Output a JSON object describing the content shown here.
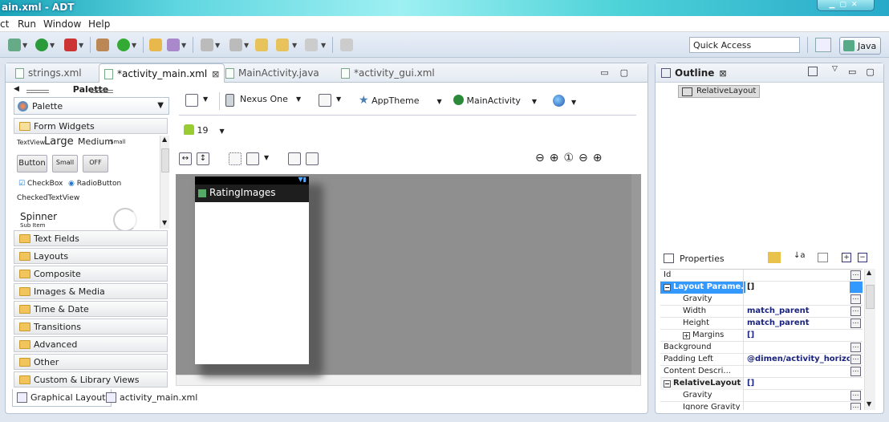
{
  "window": {
    "title": "ain.xml - ADT"
  },
  "menu": {
    "items": [
      "ct",
      "Run",
      "Window",
      "Help"
    ]
  },
  "toolbar": {
    "quick_access": "Quick Access",
    "perspective": "Java"
  },
  "editor": {
    "tabs": [
      {
        "label": "strings.xml"
      },
      {
        "label": "*activity_main.xml",
        "active": true,
        "close": "⊠"
      },
      {
        "label": "MainActivity.java"
      },
      {
        "label": "*activity_gui.xml"
      }
    ],
    "bottom_tabs": [
      "Graphical Layout",
      "activity_main.xml"
    ]
  },
  "palette": {
    "header": "Palette",
    "dropdown": "Palette",
    "open_category": "Form Widgets",
    "widgets": {
      "textview": "TextView",
      "large": "Large",
      "medium": "Medium",
      "small_text": "Small",
      "button": "Button",
      "small_button": "Small",
      "toggle": "OFF",
      "checkbox": "CheckBox",
      "radio": "RadioButton",
      "checked_text": "CheckedTextView",
      "spinner": "Spinner",
      "sub_item": "Sub Item"
    },
    "categories": [
      "Text Fields",
      "Layouts",
      "Composite",
      "Images & Media",
      "Time & Date",
      "Transitions",
      "Advanced",
      "Other",
      "Custom & Library Views"
    ]
  },
  "config": {
    "device": "Nexus One",
    "theme": "AppTheme",
    "activity": "MainActivity",
    "api": "19"
  },
  "preview": {
    "app_title": "RatingImages"
  },
  "outline": {
    "title": "Outline",
    "root": "RelativeLayout"
  },
  "properties": {
    "title": "Properties",
    "rows": [
      {
        "key": "Id",
        "value": "",
        "indent": 0
      },
      {
        "key": "Layout Parame...",
        "value": "[]",
        "indent": 0,
        "expander": "−",
        "selected": true
      },
      {
        "key": "Gravity",
        "value": "",
        "indent": 1
      },
      {
        "key": "Width",
        "value": "match_parent",
        "indent": 1
      },
      {
        "key": "Height",
        "value": "match_parent",
        "indent": 1
      },
      {
        "key": "Margins",
        "value": "[]",
        "indent": 1,
        "expander": "+"
      },
      {
        "key": "Background",
        "value": "",
        "indent": 0
      },
      {
        "key": "Padding Left",
        "value": "@dimen/activity_horizon...",
        "indent": 0
      },
      {
        "key": "Content Descri...",
        "value": "",
        "indent": 0
      },
      {
        "key": "RelativeLayout",
        "value": "[]",
        "indent": 0,
        "expander": "−"
      },
      {
        "key": "Gravity",
        "value": "",
        "indent": 1
      },
      {
        "key": "Ignore Gravity",
        "value": "",
        "indent": 1
      }
    ]
  },
  "colors": {
    "selection": "#3399ff",
    "canvas": "#8f8f8f",
    "folder": "#f2c45c"
  }
}
